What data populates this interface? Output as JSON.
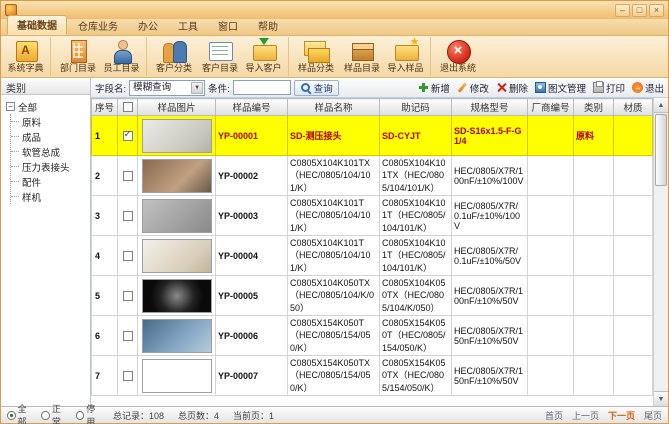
{
  "window": {
    "title": "",
    "minimize": "–",
    "maximize": "□",
    "close": "×"
  },
  "menu": {
    "tabs": [
      {
        "label": "基础数据",
        "active": true
      },
      {
        "label": "仓库业务"
      },
      {
        "label": "办公"
      },
      {
        "label": "工具"
      },
      {
        "label": "窗口"
      },
      {
        "label": "帮助"
      }
    ]
  },
  "ribbon": {
    "buttons": [
      {
        "label": "系统字典",
        "icon": "dict",
        "sep": true
      },
      {
        "label": "部门目录",
        "icon": "dept"
      },
      {
        "label": "员工目录",
        "icon": "staff",
        "sep": true
      },
      {
        "label": "客户分类",
        "icon": "cust-class"
      },
      {
        "label": "客户目录",
        "icon": "cust-list"
      },
      {
        "label": "导入客户",
        "icon": "import-cust",
        "sep": true
      },
      {
        "label": "样品分类",
        "icon": "sample-class"
      },
      {
        "label": "样品目录",
        "icon": "sample-list"
      },
      {
        "label": "导入样品",
        "icon": "import-sample",
        "sep": true
      },
      {
        "label": "退出系统",
        "icon": "exit-system"
      }
    ]
  },
  "sidebar": {
    "title": "类别",
    "tree": {
      "root": "全部",
      "children": [
        "原料",
        "成品",
        "软管总成",
        "压力表接头",
        "配件",
        "样机"
      ]
    }
  },
  "filterbar": {
    "field_label": "字段名:",
    "field_value": "模糊查询",
    "condition_label": "条件:",
    "condition_value": "",
    "search_label": "查询",
    "actions": [
      {
        "label": "新增",
        "icon": "add"
      },
      {
        "label": "修改",
        "icon": "edit"
      },
      {
        "label": "删除",
        "icon": "delete"
      },
      {
        "label": "图文管理",
        "icon": "media"
      },
      {
        "label": "打印",
        "icon": "print"
      },
      {
        "label": "退出",
        "icon": "exit"
      }
    ]
  },
  "table": {
    "columns": [
      "序号",
      "",
      "样品图片",
      "样品编号",
      "样品名称",
      "助记码",
      "规格型号",
      "厂商编号",
      "类别",
      "材质"
    ],
    "rows": [
      {
        "num": "1",
        "checked": true,
        "highlight": true,
        "code": "YP-00001",
        "name": "SD-测压接头",
        "mnemonic": "SD-CYJT",
        "spec": "SD-S16x1.5-F-G1/4",
        "vendor": "",
        "category": "原料",
        "material": ""
      },
      {
        "num": "2",
        "checked": false,
        "code": "YP-00002",
        "name": "C0805X104K101TX（HEC/0805/104/101/K）",
        "mnemonic": "C0805X104K101TX（HEC/0805/104/101/K）",
        "spec": "HEC/0805/X7R/100nF/±10%/100V",
        "vendor": "",
        "category": "",
        "material": ""
      },
      {
        "num": "3",
        "checked": false,
        "code": "YP-00003",
        "name": "C0805X104K101T（HEC/0805/104/101/K）",
        "mnemonic": "C0805X104K101T（HEC/0805/104/101/K）",
        "spec": "HEC/0805/X7R/0.1uF/±10%/100V",
        "vendor": "",
        "category": "",
        "material": ""
      },
      {
        "num": "4",
        "checked": false,
        "code": "YP-00004",
        "name": "C0805X104K101T（HEC/0805/104/101/K）",
        "mnemonic": "C0805X104K101T（HEC/0805/104/101/K）",
        "spec": "HEC/0805/X7R/0.1uF/±10%/50V",
        "vendor": "",
        "category": "",
        "material": ""
      },
      {
        "num": "5",
        "checked": false,
        "code": "YP-00005",
        "name": "C0805X104K050TX（HEC/0805/104/K/050）",
        "mnemonic": "C0805X104K050TX（HEC/0805/104/K/050）",
        "spec": "HEC/0805/X7R/100nF/±10%/50V",
        "vendor": "",
        "category": "",
        "material": ""
      },
      {
        "num": "6",
        "checked": false,
        "code": "YP-00006",
        "name": "C0805X154K050T（HEC/0805/154/050/K）",
        "mnemonic": "C0805X154K050T（HEC/0805/154/050/K）",
        "spec": "HEC/0805/X7R/150nF/±10%/50V",
        "vendor": "",
        "category": "",
        "material": ""
      },
      {
        "num": "7",
        "checked": false,
        "code": "YP-00007",
        "name": "C0805X154K050TX（HEC/0805/154/050/K）",
        "mnemonic": "C0805X154K050TX（HEC/0805/154/050/K）",
        "spec": "HEC/0805/X7R/150nF/±10%/50V",
        "vendor": "",
        "category": "",
        "material": ""
      }
    ]
  },
  "statusbar": {
    "radios": [
      {
        "label": "全部",
        "checked": true
      },
      {
        "label": "正常",
        "checked": false
      },
      {
        "label": "停用",
        "checked": false
      }
    ],
    "records": "总记录：108",
    "pages": "总页数：4",
    "current": "当前页：1",
    "pagination": [
      {
        "label": "首页"
      },
      {
        "label": "上一页"
      },
      {
        "label": "下一页",
        "active": true
      },
      {
        "label": "尾页"
      }
    ]
  }
}
